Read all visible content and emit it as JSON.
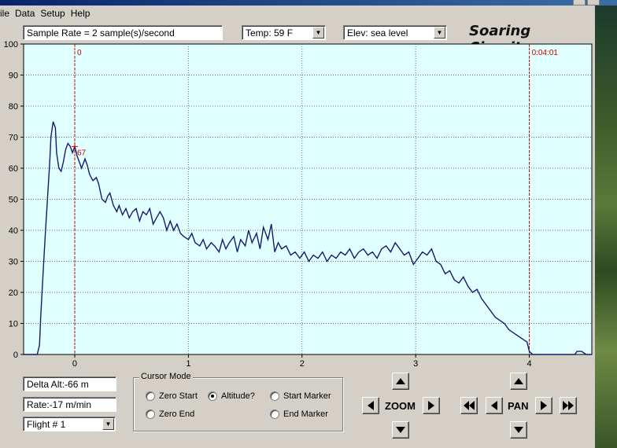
{
  "menu": [
    "ile",
    "Data",
    "Setup",
    "Help"
  ],
  "toolbar": {
    "sample_rate": "Sample Rate =  2 sample(s)/second",
    "temp": "Temp:  59 F",
    "elev": "Elev: sea level"
  },
  "brand": "Soaring Circuits",
  "status": {
    "delta_alt": "Delta Alt:-66 m",
    "rate": "Rate:-17 m/min",
    "flight": "Flight # 1"
  },
  "cursor_mode": {
    "legend": "Cursor Mode",
    "options": [
      {
        "label": "Zero Start",
        "checked": false
      },
      {
        "label": "Altitude?",
        "checked": true
      },
      {
        "label": "Start Marker",
        "checked": false
      },
      {
        "label": "Zero End",
        "checked": false
      },
      {
        "label": "End Marker",
        "checked": false
      }
    ]
  },
  "controls": {
    "zoom": "ZOOM",
    "pan": "PAN"
  },
  "colors": {
    "plot_bg": "#e0ffff",
    "line": "#1a1a6e",
    "marker": "#cc0000",
    "grid": "#6e7070"
  },
  "chart_data": {
    "type": "line",
    "ylim": [
      0,
      100
    ],
    "xlim": [
      -0.45,
      4.55
    ],
    "yticks": [
      "0",
      "10",
      "20",
      "30",
      "40",
      "50",
      "60",
      "70",
      "80",
      "90",
      "100"
    ],
    "xticks": [
      "0",
      "1",
      "2",
      "3",
      "4"
    ],
    "grid": true,
    "markers": [
      {
        "x": 0,
        "label": "0"
      },
      {
        "x": 4,
        "label": "0:04:01"
      }
    ],
    "cursor": {
      "x": 0,
      "y": 67,
      "label": "67"
    },
    "series": [
      {
        "x": [
          -0.45,
          -0.33,
          -0.31,
          -0.3,
          -0.28,
          -0.26,
          -0.24,
          -0.22,
          -0.21,
          -0.19,
          -0.17,
          -0.16,
          -0.14,
          -0.12,
          -0.1,
          -0.08,
          -0.06,
          -0.04,
          -0.02,
          0,
          0.02,
          0.04,
          0.06,
          0.09,
          0.11,
          0.13,
          0.16,
          0.19,
          0.21,
          0.24,
          0.27,
          0.29,
          0.31,
          0.34,
          0.37,
          0.39,
          0.42,
          0.45,
          0.48,
          0.51,
          0.54,
          0.57,
          0.6,
          0.63,
          0.66,
          0.69,
          0.72,
          0.75,
          0.78,
          0.81,
          0.84,
          0.87,
          0.9,
          0.93,
          0.96,
          1.0,
          1.03,
          1.06,
          1.1,
          1.13,
          1.16,
          1.2,
          1.23,
          1.27,
          1.3,
          1.33,
          1.36,
          1.4,
          1.43,
          1.46,
          1.5,
          1.53,
          1.56,
          1.6,
          1.63,
          1.66,
          1.7,
          1.73,
          1.76,
          1.79,
          1.82,
          1.86,
          1.9,
          1.94,
          1.98,
          2.02,
          2.06,
          2.1,
          2.14,
          2.18,
          2.22,
          2.26,
          2.3,
          2.34,
          2.38,
          2.42,
          2.46,
          2.5,
          2.54,
          2.58,
          2.62,
          2.66,
          2.7,
          2.74,
          2.78,
          2.82,
          2.86,
          2.9,
          2.94,
          2.98,
          3.02,
          3.06,
          3.1,
          3.14,
          3.18,
          3.22,
          3.26,
          3.3,
          3.34,
          3.38,
          3.42,
          3.46,
          3.5,
          3.54,
          3.58,
          3.62,
          3.66,
          3.7,
          3.74,
          3.78,
          3.82,
          3.86,
          3.9,
          3.94,
          3.98,
          4.0,
          4.03,
          4.4,
          4.42,
          4.46,
          4.5,
          4.55
        ],
        "y": [
          0,
          0,
          3,
          12,
          25,
          38,
          50,
          62,
          70,
          75,
          73,
          65,
          60,
          59,
          62,
          66,
          68,
          67,
          65,
          67,
          64,
          62,
          60,
          63,
          61,
          58,
          56,
          57,
          55,
          50,
          49,
          51,
          52,
          48,
          46,
          48,
          45,
          47,
          44,
          46,
          47,
          43,
          46,
          45,
          47,
          42,
          44,
          46,
          44,
          40,
          43,
          40,
          42,
          39,
          38,
          37,
          39,
          36,
          35,
          37,
          34,
          36,
          35,
          33,
          37,
          34,
          36,
          38,
          33,
          37,
          35,
          40,
          36,
          39,
          34,
          41,
          37,
          42,
          33,
          36,
          34,
          35,
          32,
          33,
          31,
          33,
          30,
          32,
          31,
          33,
          30,
          32,
          31,
          33,
          32,
          34,
          31,
          33,
          34,
          32,
          33,
          31,
          34,
          35,
          33,
          36,
          34,
          32,
          33,
          29,
          31,
          33,
          32,
          34,
          30,
          29,
          26,
          27,
          24,
          23,
          25,
          22,
          20,
          21,
          18,
          16,
          14,
          12,
          11,
          10,
          8,
          7,
          6,
          5,
          4,
          1,
          0,
          0,
          1,
          1,
          0,
          0
        ]
      }
    ]
  }
}
